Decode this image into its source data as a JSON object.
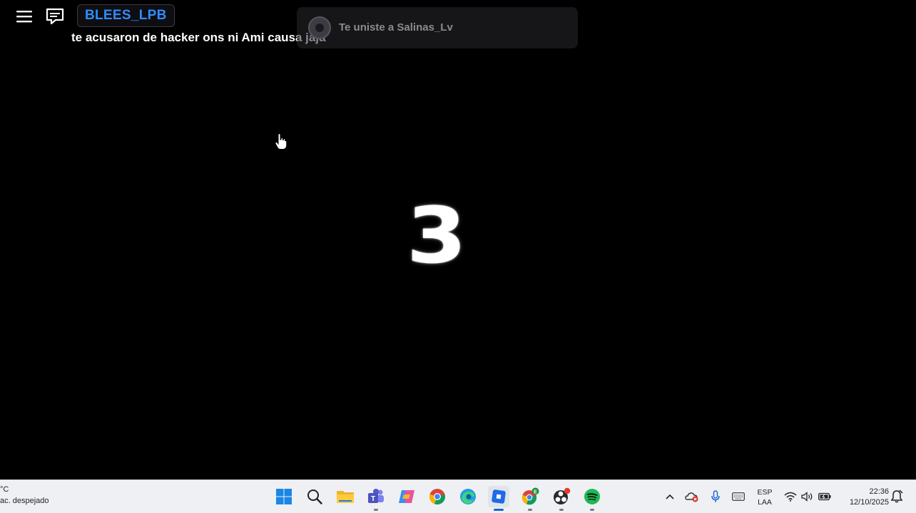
{
  "game": {
    "player_name": "BLEES_LPB",
    "chat_message": "te acusaron de hacker ons ni Ami causa jaja",
    "join_notification": "Te uniste a Salinas_Lv",
    "countdown": "3"
  },
  "taskbar": {
    "weather_temp": "°C",
    "weather_condition": "ac. despejado",
    "language_line1": "ESP",
    "language_line2": "LAA",
    "time": "22:36",
    "date": "12/10/2025",
    "apps": [
      "start-icon",
      "search-icon",
      "file-explorer-icon",
      "teams-icon",
      "copilot-icon",
      "chrome-icon",
      "edge-icon",
      "roblox-icon",
      "chrome-profile-icon",
      "obs-icon",
      "spotify-icon"
    ],
    "tray": [
      "chevron-up-icon",
      "onedrive-icon",
      "microphone-icon",
      "keyboard-icon",
      "wifi-icon",
      "volume-icon",
      "battery-icon",
      "notification-bell-icon"
    ]
  },
  "colors": {
    "player_name": "#2f8dff",
    "taskbar_bg": "#eef0f4",
    "game_bg": "#000000"
  }
}
